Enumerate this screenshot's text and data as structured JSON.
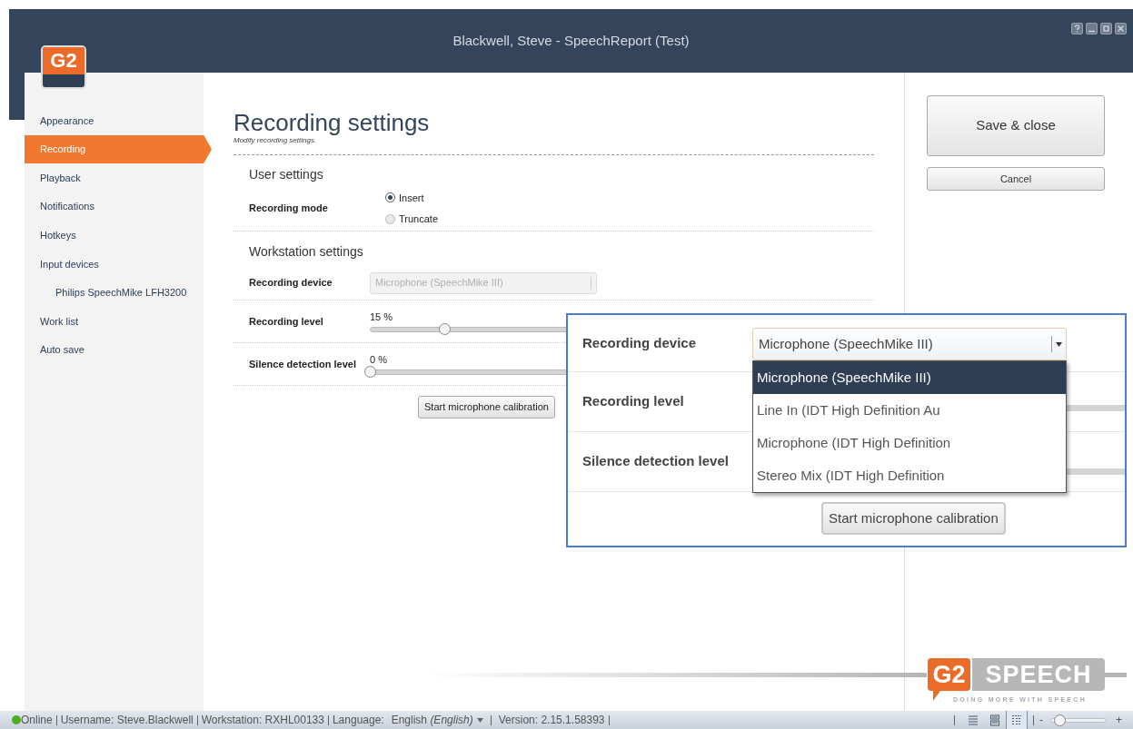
{
  "window": {
    "title": "Blackwell, Steve - SpeechReport (Test)",
    "logo": "G2"
  },
  "sidebar": {
    "items": [
      {
        "label": "Appearance",
        "selected": false
      },
      {
        "label": "Recording",
        "selected": true
      },
      {
        "label": "Playback",
        "selected": false
      },
      {
        "label": "Notifications",
        "selected": false
      },
      {
        "label": "Hotkeys",
        "selected": false
      },
      {
        "label": "Input devices",
        "selected": false,
        "children": [
          {
            "label": "Philips SpeechMike LFH3200",
            "selected": false
          }
        ]
      },
      {
        "label": "Work list",
        "selected": false
      },
      {
        "label": "Auto save",
        "selected": false
      }
    ]
  },
  "page": {
    "title": "Recording settings",
    "subtitle": "Modify recording settings."
  },
  "user_settings": {
    "heading": "User settings",
    "recording_mode": {
      "label": "Recording mode",
      "options": [
        {
          "label": "Insert",
          "selected": true
        },
        {
          "label": "Truncate",
          "selected": false
        }
      ]
    }
  },
  "workstation_settings": {
    "heading": "Workstation settings",
    "recording_device": {
      "label": "Recording device",
      "value": "Microphone (SpeechMike III)",
      "disabled": true
    },
    "recording_level": {
      "label": "Recording level",
      "reading": "15 %",
      "level": 0.15
    },
    "silence_detection_level": {
      "label": "Silence detection level",
      "reading": "0 %",
      "level": 0
    },
    "calibration_button": "Start microphone calibration"
  },
  "actions": {
    "save": "Save & close",
    "cancel": "Cancel"
  },
  "magnified_callout": {
    "recording_device_label": "Recording device",
    "combo_value": "Microphone (SpeechMike III)",
    "options": [
      {
        "label": "Microphone (SpeechMike III)",
        "selected": true
      },
      {
        "label": "Line In (IDT High Definition Au",
        "selected": false
      },
      {
        "label": "Microphone (IDT High Definition",
        "selected": false
      },
      {
        "label": "Stereo Mix (IDT High Definition",
        "selected": false
      }
    ],
    "recording_level_label": "Recording level",
    "silence_detection_label": "Silence detection level",
    "calibration_button": "Start microphone calibration"
  },
  "footer_logo": {
    "mark": "G2",
    "word": "SPEECH",
    "tagline": "DOING MORE WITH SPEECH"
  },
  "status_bar": {
    "status": "Online",
    "items": [
      "Username: Steve.Blackwell",
      "Workstation: RXHL00133"
    ],
    "language_label": "Language:",
    "language_value": "English *(English)*",
    "version": "Version: 2.15.1.58393",
    "view_buttons": [
      {
        "selected": false
      },
      {
        "selected": false
      },
      {
        "selected": true
      }
    ],
    "zoom": {
      "minus": "-",
      "plus": "+",
      "level": 0.15
    }
  }
}
